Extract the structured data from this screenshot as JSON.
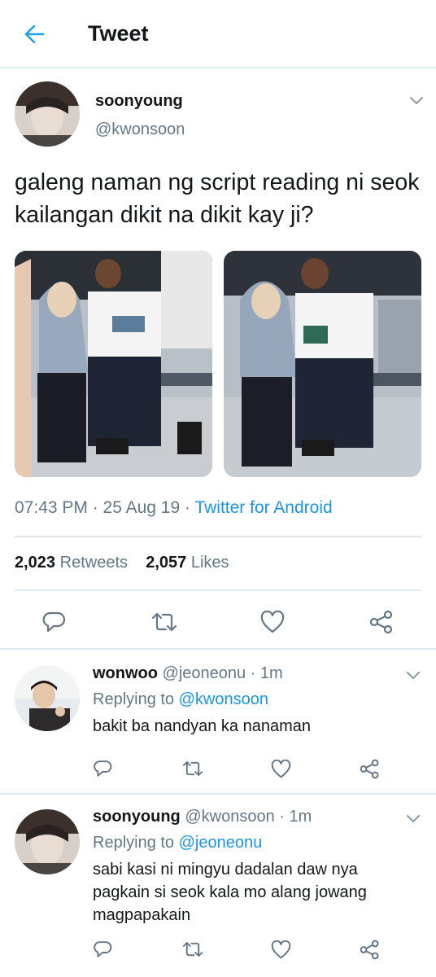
{
  "header": {
    "title": "Tweet",
    "back_icon": "arrow-left-icon",
    "accent": "#1da1f2"
  },
  "tweet": {
    "author_name": "soonyoung",
    "author_handle": "@kwonsoon",
    "text": "galeng naman ng script reading ni seok kailangan dikit na dikit kay ji?",
    "time": "07:43 PM · 25 Aug 19 · ",
    "source": "Twitter for Android",
    "retweets_count": "2,023",
    "retweets_label": "Retweets",
    "likes_count": "2,057",
    "likes_label": "Likes"
  },
  "replies": [
    {
      "name": "wonwoo",
      "handle": "@jeoneonu",
      "time": "· 1m",
      "replying_label": "Replying to",
      "replying_to": "@kwonsoon",
      "text": "bakit ba nandyan ka nanaman"
    },
    {
      "name": "soonyoung",
      "handle": "@kwonsoon",
      "time": "· 1m",
      "replying_label": "Replying to",
      "replying_to": "@jeoneonu",
      "text": "sabi kasi ni mingyu dadalan daw nya pagkain si seok kala mo alang jowang magpapakain"
    }
  ],
  "colors": {
    "link": "#1b95e0",
    "secondary_text": "#657786",
    "divider": "#e1e8ed",
    "icon": "#657786"
  }
}
